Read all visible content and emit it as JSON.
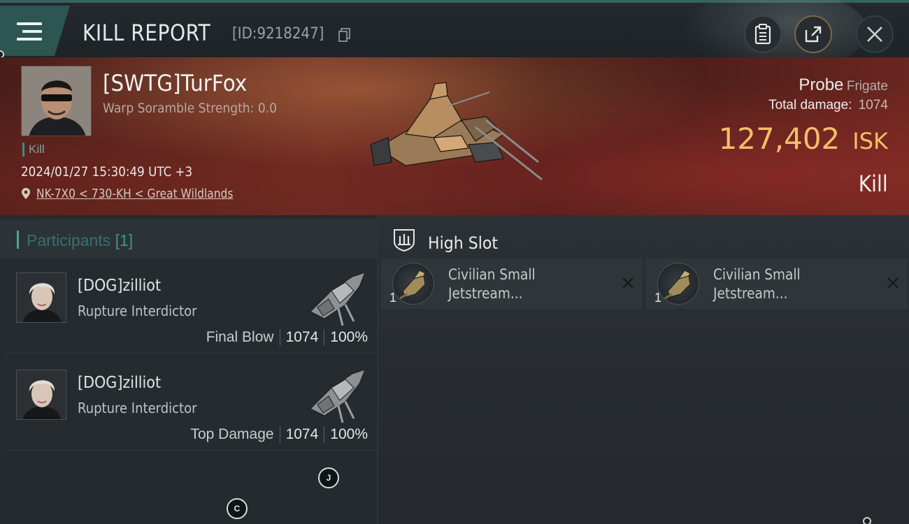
{
  "header": {
    "title": "KILL REPORT",
    "report_id": "[ID:9218247]"
  },
  "victim": {
    "name": "[SWTG]TurFox",
    "scramble": "Warp Soramble Strength: 0.0",
    "tag": "Kill",
    "datetime": "2024/01/27 15:30:49 UTC +3",
    "location": "NK-7X0 < 730-KH < Great Wildlands",
    "ship_name": "Probe",
    "ship_class": "Frigate",
    "total_damage_label": "Total damage:",
    "total_damage": "1074",
    "isk_value": "127,402",
    "isk_currency": "ISK",
    "outcome": "Kill"
  },
  "participants": {
    "label": "Participants",
    "count": "[1]",
    "list": [
      {
        "name": "[DOG]zilliot",
        "ship": "Rupture Interdictor",
        "role": "Final Blow",
        "damage": "1074",
        "percent": "100%"
      },
      {
        "name": "[DOG]zilliot",
        "ship": "Rupture Interdictor",
        "role": "Top Damage",
        "damage": "1074",
        "percent": "100%"
      }
    ]
  },
  "slots": {
    "title": "High Slot",
    "modules": [
      {
        "name": "Civilian Small Jetstream...",
        "qty": "1"
      },
      {
        "name": "Civilian Small Jetstream...",
        "qty": "1"
      }
    ]
  },
  "overlay_badges": [
    "J",
    "C"
  ],
  "icons": {
    "menu": "hamburger-menu-icon",
    "copy": "copy-icon",
    "clipboard": "clipboard-icon",
    "share": "share-icon",
    "close": "close-icon",
    "location": "map-pin-icon",
    "slot": "high-slot-icon",
    "remove": "x-icon"
  },
  "colors": {
    "accent": "#4aa59f",
    "isk": "#f1bf6a",
    "hero_bg": "#5e2a22",
    "panel_bg": "#252a2e"
  }
}
